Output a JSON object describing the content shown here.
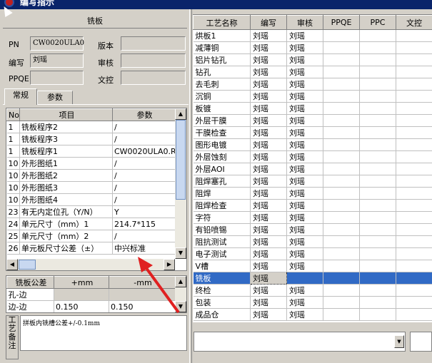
{
  "window": {
    "title": "编写指示"
  },
  "left_panel": {
    "header": "铣板",
    "fields": {
      "pn_label": "PN",
      "pn_value": "CW0020ULA0",
      "version_label": "版本",
      "version_value": "",
      "author_label": "编写",
      "author_value": "刘瑶",
      "review_label": "审核",
      "review_value": "",
      "ppqe_label": "PPQE",
      "ppqe_value": "",
      "wencontrol_label": "文控",
      "wencontrol_value": ""
    },
    "tabs": [
      {
        "label": "常规"
      },
      {
        "label": "参数"
      }
    ],
    "params_grid": {
      "headers": [
        "No",
        "项目",
        "参数"
      ],
      "rows": [
        [
          "1",
          "铣板程序2",
          "/"
        ],
        [
          "1",
          "铣板程序3",
          "/"
        ],
        [
          "1",
          "铣板程序1",
          "CW0020ULA0.ROU"
        ],
        [
          "10",
          "外形图纸1",
          "/"
        ],
        [
          "10",
          "外形图纸2",
          "/"
        ],
        [
          "10",
          "外形图纸3",
          "/"
        ],
        [
          "10",
          "外形图纸4",
          "/"
        ],
        [
          "23",
          "有无内定位孔（Y/N）",
          "Y"
        ],
        [
          "24",
          "单元尺寸（mm）1",
          "214.7*115"
        ],
        [
          "25",
          "单元尺寸（mm）2",
          "/"
        ],
        [
          "26",
          "单元板尺寸公差（±）",
          "中兴标准"
        ]
      ]
    },
    "tolerance_grid": {
      "headers": [
        "铣板公差",
        "+mm",
        "-mm"
      ],
      "rows": [
        [
          "孔-边",
          "",
          ""
        ],
        [
          "边-边",
          "0.150",
          "0.150"
        ]
      ]
    },
    "memo_label": "工艺备注",
    "memo_text": "拼板内铣槽公差+/-0.1mm"
  },
  "process_grid": {
    "headers": [
      "工艺名称",
      "编写",
      "审核",
      "PPQE",
      "PPC",
      "文控"
    ],
    "rows": [
      [
        "烘板1",
        "刘瑶",
        "刘瑶",
        "",
        "",
        ""
      ],
      [
        "减薄铜",
        "刘瑶",
        "刘瑶",
        "",
        "",
        ""
      ],
      [
        "铝片钻孔",
        "刘瑶",
        "刘瑶",
        "",
        "",
        ""
      ],
      [
        "钻孔",
        "刘瑶",
        "刘瑶",
        "",
        "",
        ""
      ],
      [
        "去毛刺",
        "刘瑶",
        "刘瑶",
        "",
        "",
        ""
      ],
      [
        "沉铜",
        "刘瑶",
        "刘瑶",
        "",
        "",
        ""
      ],
      [
        "板镀",
        "刘瑶",
        "刘瑶",
        "",
        "",
        ""
      ],
      [
        "外层干膜",
        "刘瑶",
        "刘瑶",
        "",
        "",
        ""
      ],
      [
        "干膜检查",
        "刘瑶",
        "刘瑶",
        "",
        "",
        ""
      ],
      [
        "图形电镀",
        "刘瑶",
        "刘瑶",
        "",
        "",
        ""
      ],
      [
        "外层蚀刻",
        "刘瑶",
        "刘瑶",
        "",
        "",
        ""
      ],
      [
        "外层AOI",
        "刘瑶",
        "刘瑶",
        "",
        "",
        ""
      ],
      [
        "阻焊塞孔",
        "刘瑶",
        "刘瑶",
        "",
        "",
        ""
      ],
      [
        "阻焊",
        "刘瑶",
        "刘瑶",
        "",
        "",
        ""
      ],
      [
        "阻焊检查",
        "刘瑶",
        "刘瑶",
        "",
        "",
        ""
      ],
      [
        "字符",
        "刘瑶",
        "刘瑶",
        "",
        "",
        ""
      ],
      [
        "有铅喷锡",
        "刘瑶",
        "刘瑶",
        "",
        "",
        ""
      ],
      [
        "阻抗测试",
        "刘瑶",
        "刘瑶",
        "",
        "",
        ""
      ],
      [
        "电子测试",
        "刘瑶",
        "刘瑶",
        "",
        "",
        ""
      ],
      [
        "V槽",
        "刘瑶",
        "刘瑶",
        "",
        "",
        ""
      ],
      [
        "铣板",
        "刘瑶",
        "",
        "",
        "",
        ""
      ],
      [
        "终检",
        "刘瑶",
        "刘瑶",
        "",
        "",
        ""
      ],
      [
        "包装",
        "刘瑶",
        "刘瑶",
        "",
        "",
        ""
      ],
      [
        "成品仓",
        "刘瑶",
        "刘瑶",
        "",
        "",
        ""
      ]
    ],
    "selected_row": "铣板"
  },
  "colors": {
    "selection": "#316ac5",
    "annotation_arrow": "#e02020"
  }
}
